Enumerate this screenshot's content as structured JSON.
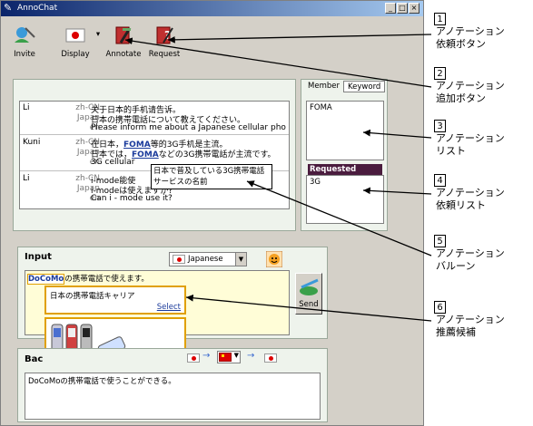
{
  "window": {
    "title": "AnnoChat",
    "controls": [
      "_",
      "□",
      "×"
    ]
  },
  "toolbar": {
    "invite": "Invite",
    "display": "Display",
    "annotate": "Annotate",
    "request": "Request"
  },
  "comments": [
    {
      "user": "Li",
      "lines": [
        {
          "lang": "zh-CN",
          "text": "关于日本的手机请告诉。"
        },
        {
          "lang": "Japan",
          "text": "日本の携帯電話について教えてください。"
        },
        {
          "lang": "en",
          "text": "Please inform me about a Japanese cellular pho"
        }
      ]
    },
    {
      "user": "Kuni",
      "lines": [
        {
          "lang": "zh-CN",
          "pre": "在日本，",
          "link": "FOMA",
          "post": "等的3G手机是主流。"
        },
        {
          "lang": "Japan",
          "pre": "日本では，",
          "link": "FOMA",
          "post": "などの3G携帯電話が主流です。"
        },
        {
          "lang": "en",
          "text": "3G cellular"
        }
      ]
    },
    {
      "user": "Li",
      "lines": [
        {
          "lang": "zh-CN",
          "text": "i-mode能使"
        },
        {
          "lang": "Japan",
          "text": "i-modeは使えますか?"
        },
        {
          "lang": "en",
          "text": "Can i - mode use it?"
        }
      ]
    }
  ],
  "balloon": {
    "text": "日本で普及している3G携帯電話サービスの名前"
  },
  "side_tabs": {
    "member": "Member",
    "keyword": "Keyword"
  },
  "keyword_list": [
    "FOMA"
  ],
  "requested": {
    "header": "Requested",
    "items": [
      "3G"
    ]
  },
  "input": {
    "title": "Input",
    "language": "Japanese",
    "highlight": "DoCoMo",
    "text_rest": "の携帯電話で使えます。",
    "suggest1": "日本の携帯電話キャリア",
    "select_label": "Select",
    "send": "Send"
  },
  "back": {
    "title": "Bac",
    "text": "DoCoMoの携帯電話で使うことができる。"
  },
  "annotations": [
    {
      "num": "1",
      "lines": [
        "アノテーション",
        "依頼ボタン"
      ]
    },
    {
      "num": "2",
      "lines": [
        "アノテーション",
        "追加ボタン"
      ]
    },
    {
      "num": "3",
      "lines": [
        "アノテーション",
        "リスト"
      ]
    },
    {
      "num": "4",
      "lines": [
        "アノテーション",
        "依頼リスト"
      ]
    },
    {
      "num": "5",
      "lines": [
        "アノテーション",
        "バルーン"
      ]
    },
    {
      "num": "6",
      "lines": [
        "アノテーション",
        "推薦候補"
      ]
    }
  ],
  "colors": {
    "accent_title": "#0a246a",
    "requested_header": "#4a1c3e",
    "suggest_border": "#e0a000",
    "link": "#1a3a9b"
  },
  "icons": [
    "annochat-logo-icon",
    "invite-icon",
    "japan-flag-icon",
    "annotate-icon",
    "request-icon",
    "smiley-icon",
    "send-icon",
    "phone-images"
  ]
}
